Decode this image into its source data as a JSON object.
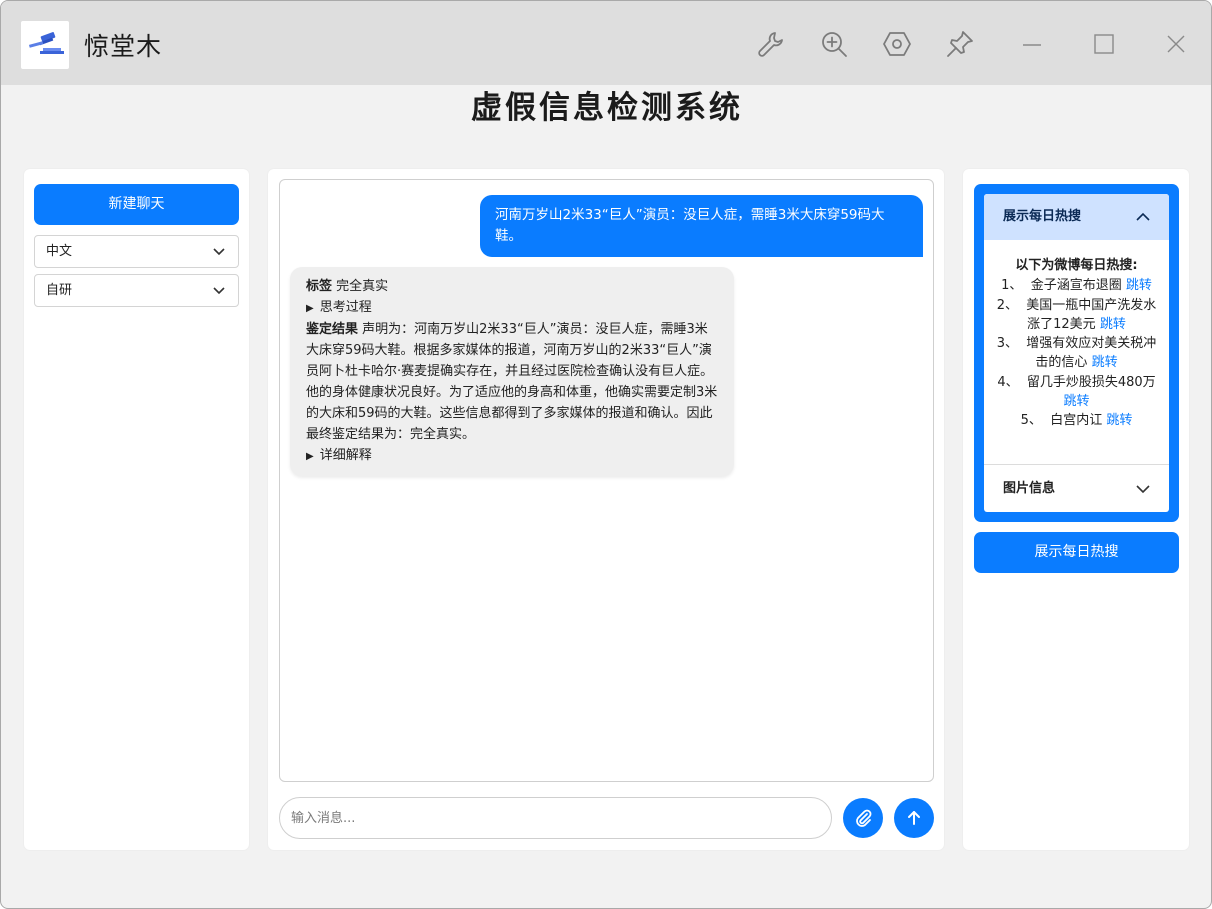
{
  "window": {
    "app_title": "惊堂木",
    "toolbar_icons": [
      "wrench-icon",
      "zoom-in-icon",
      "hexagon-settings-icon",
      "pin-icon"
    ],
    "window_controls": [
      "minimize-icon",
      "maximize-icon",
      "close-icon"
    ]
  },
  "page": {
    "title": "虚假信息检测系统"
  },
  "sidebar": {
    "new_chat_label": "新建聊天",
    "language_select": "中文",
    "model_select": "自研"
  },
  "chat": {
    "user_message": "河南万岁山2米33“巨人”演员：没巨人症，需睡3米大床穿59码大鞋。",
    "bot": {
      "label_key": "标签",
      "label_value": "完全真实",
      "thinking_toggle": "思考过程",
      "result_key": "鉴定结果",
      "result_text": "声明为：河南万岁山2米33“巨人”演员：没巨人症，需睡3米大床穿59码大鞋。根据多家媒体的报道，河南万岁山的2米33“巨人”演员阿卜杜卡哈尔·赛麦提确实存在，并且经过医院检查确认没有巨人症。他的身体健康状况良好。为了适应他的身高和体重，他确实需要定制3米的大床和59码的大鞋。这些信息都得到了多家媒体的报道和确认。因此最终鉴定结果为：完全真实。",
      "detail_toggle": "详细解释"
    },
    "input_placeholder": "输入消息..."
  },
  "hotsearch": {
    "panel_title": "展示每日热搜",
    "list_title": "以下为微博每日热搜:",
    "jump_label": "跳转",
    "items": [
      {
        "num": "1、",
        "text": "金子涵宣布退圈"
      },
      {
        "num": "2、",
        "text": "美国一瓶中国产洗发水涨了12美元"
      },
      {
        "num": "3、",
        "text": "增强有效应对美关税冲击的信心"
      },
      {
        "num": "4、",
        "text": "留几手炒股损失480万"
      },
      {
        "num": "5、",
        "text": "白宫内讧"
      }
    ],
    "image_info_title": "图片信息",
    "show_button": "展示每日热搜"
  },
  "colors": {
    "accent": "#0a7cff",
    "accordion_header": "#cfe2ff",
    "titlebar": "#dedede",
    "background": "#f2f2f2"
  }
}
